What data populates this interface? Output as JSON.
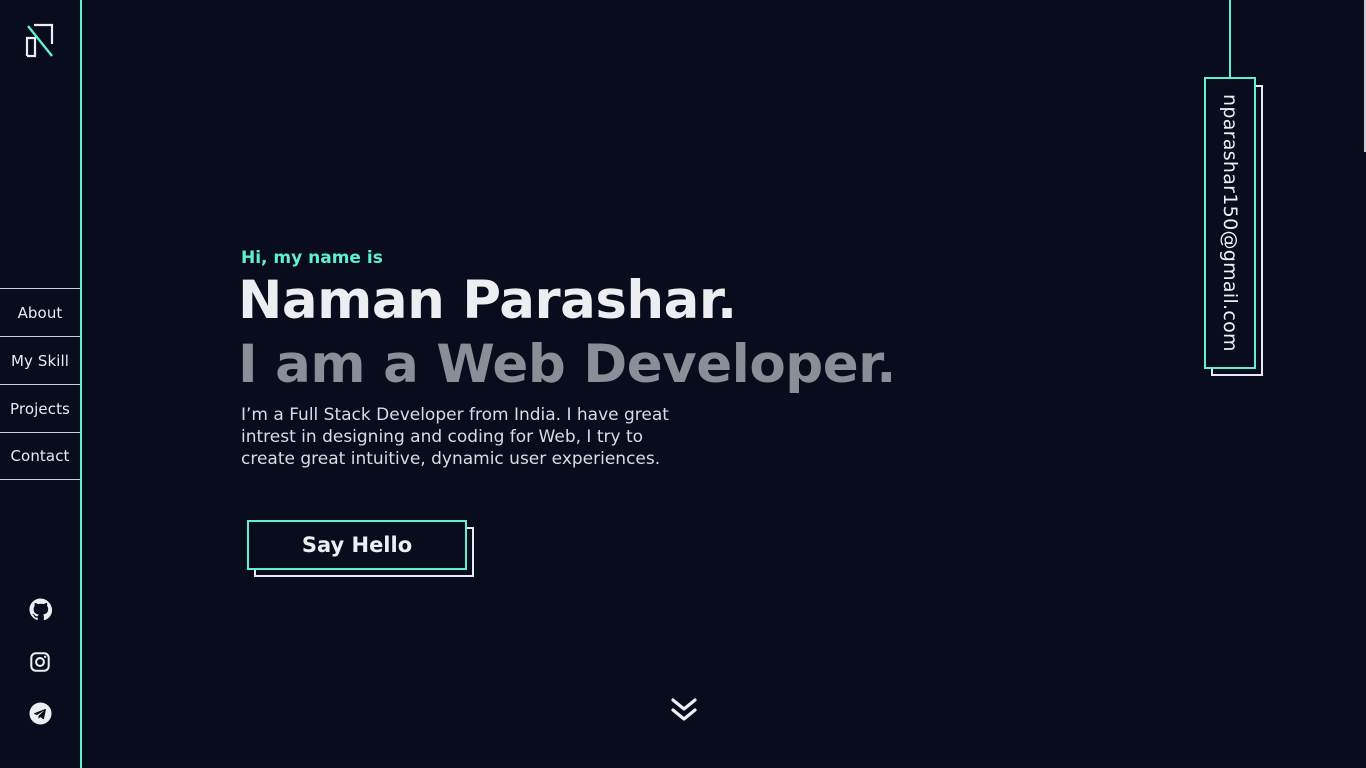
{
  "sidebar": {
    "logo": "naman-logo",
    "nav": [
      {
        "label": "About"
      },
      {
        "label": "My Skill"
      },
      {
        "label": "Projects"
      },
      {
        "label": "Contact"
      }
    ],
    "social_icons": [
      "github-icon",
      "instagram-icon",
      "telegram-icon"
    ]
  },
  "hero": {
    "greeting": "Hi, my name is",
    "name": "Naman Parashar.",
    "role": "I am a Web Developer.",
    "bio": "I’m a Full Stack Developer from India. I have great intrest in designing and coding for Web, I try to create great intuitive, dynamic user experiences.",
    "cta_label": "Say Hello"
  },
  "email": "nparashar150@gmail.com",
  "colors": {
    "background": "#080c1c",
    "accent": "#5ff0d2",
    "text": "#eceef2",
    "muted": "#8b8e96"
  }
}
